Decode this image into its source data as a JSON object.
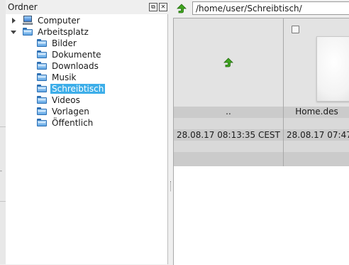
{
  "folder_panel": {
    "title": "Ordner",
    "float_glyph": "⧉",
    "close_glyph": "✕",
    "items": [
      {
        "label": "Computer",
        "icon": "computer-icon",
        "expanded": false
      },
      {
        "label": "Arbeitsplatz",
        "icon": "folder-icon",
        "expanded": true
      },
      {
        "label": "Bilder",
        "icon": "folder-icon"
      },
      {
        "label": "Dokumente",
        "icon": "folder-icon"
      },
      {
        "label": "Downloads",
        "icon": "folder-icon"
      },
      {
        "label": "Musik",
        "icon": "folder-icon"
      },
      {
        "label": "Schreibtisch",
        "icon": "folder-icon",
        "selected": true
      },
      {
        "label": "Videos",
        "icon": "folder-icon"
      },
      {
        "label": "Vorlagen",
        "icon": "folder-icon"
      },
      {
        "label": "Öffentlich",
        "icon": "folder-icon"
      }
    ]
  },
  "toolbar": {
    "path": "/home/user/Schreibtisch/",
    "up_icon": "go-up-icon"
  },
  "files": [
    {
      "name": "..",
      "date": "28.08.17 08:13:35 CEST",
      "icon": "go-up-icon"
    },
    {
      "name": "Home.des",
      "date": "28.08.17 07:47",
      "icon": "desktop-file-thumbnail"
    }
  ],
  "colors": {
    "selection": "#3daee9",
    "arrow_green": "#3fa51f"
  }
}
